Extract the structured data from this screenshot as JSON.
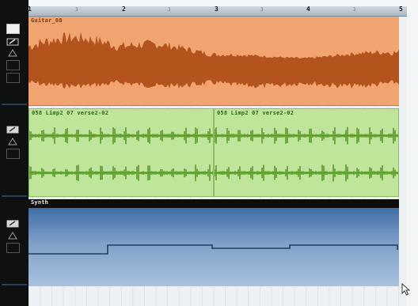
{
  "ruler": {
    "bars": [
      "1",
      "2",
      "3",
      "4",
      "5"
    ],
    "beats": [
      "3",
      "3",
      "3",
      "3"
    ]
  },
  "tracks": {
    "guitar": {
      "clip_name": "Guitar_08"
    },
    "loop": {
      "clip1_name": "058 Limp2 07 verse2-02",
      "clip2_name": "058 Limp2 07 verse2-02"
    },
    "synth": {
      "clip_name": "Synth"
    }
  },
  "colors": {
    "guitar_clip": "#f1a46f",
    "guitar_wave": "#b4541d",
    "loop_clip": "#bfe59a",
    "loop_wave": "#5a9a2a",
    "synth_clip": "#6f93c0",
    "synth_line": "#1e3e63"
  },
  "icons": [
    "track-toggle-square-icon",
    "track-edit-icon",
    "mouse-cursor-icon"
  ]
}
